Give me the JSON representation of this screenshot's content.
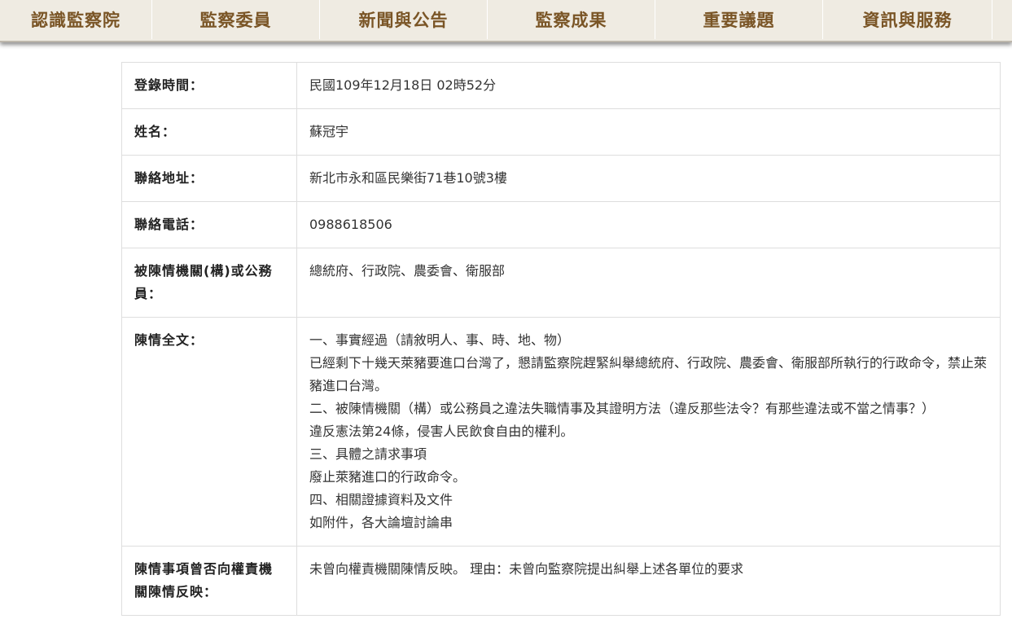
{
  "nav": {
    "items": [
      "認識監察院",
      "監察委員",
      "新聞與公告",
      "監察成果",
      "重要議題",
      "資訊與服務"
    ]
  },
  "record": {
    "login_time": {
      "label": "登錄時間：",
      "value": "民國109年12月18日 02時52分"
    },
    "name": {
      "label": "姓名：",
      "value": "蘇冠宇"
    },
    "address": {
      "label": "聯絡地址：",
      "value": "新北市永和區民樂街71巷10號3樓"
    },
    "phone": {
      "label": "聯絡電話：",
      "value": "0988618506"
    },
    "target": {
      "label": "被陳情機關(構)或公務員：",
      "value": "總統府、行政院、農委會、衛服部"
    },
    "content": {
      "label": "陳情全文：",
      "lines": [
        "一、事實經過（請敘明人、事、時、地、物）",
        "已經剩下十幾天萊豬要進口台灣了，懇請監察院趕緊糾舉總統府、行政院、農委會、衛服部所執行的行政命令，禁止萊豬進口台灣。",
        "二、被陳情機關（構）或公務員之違法失職情事及其證明方法（違反那些法令？有那些違法或不當之情事？）",
        "違反憲法第24條，侵害人民飲食自由的權利。",
        "三、具體之請求事項",
        "廢止萊豬進口的行政命令。",
        "四、相關證據資料及文件",
        "如附件，各大論壇討論串"
      ]
    },
    "prior": {
      "label": "陳情事項曾否向權責機關陳情反映：",
      "value": "未曾向權責機關陳情反映。 理由：未曾向監察院提出糾舉上述各單位的要求"
    }
  }
}
